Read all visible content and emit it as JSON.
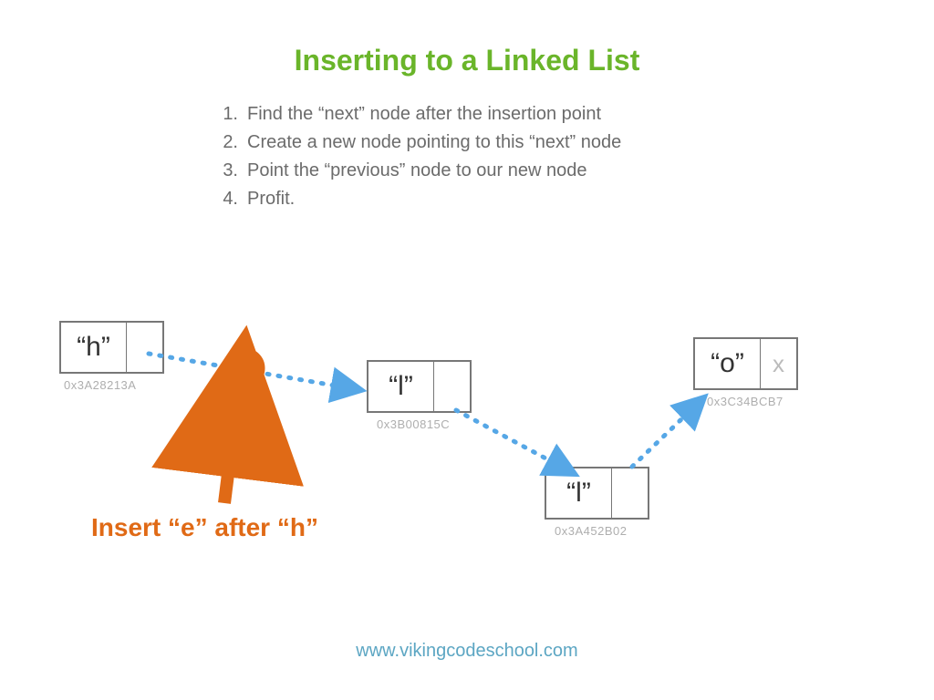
{
  "title": "Inserting to a Linked List",
  "steps": [
    "Find the “next” node after the insertion point",
    "Create a new node pointing to this “next” node",
    "Point the “previous” node to our new node",
    "Profit."
  ],
  "nodes": {
    "h": {
      "value": "“h”",
      "ptr": "",
      "addr": "0x3A28213A"
    },
    "l1": {
      "value": "“l”",
      "ptr": "",
      "addr": "0x3B00815C"
    },
    "l2": {
      "value": "“l”",
      "ptr": "",
      "addr": "0x3A452B02"
    },
    "o": {
      "value": "“o”",
      "ptr": "x",
      "addr": "0x3C34BCB7"
    }
  },
  "insert_label": "Insert “e” after “h”",
  "footer": "www.vikingcodeschool.com",
  "colors": {
    "title": "#6ab52a",
    "arrow_blue": "#56a7e6",
    "accent_orange": "#e06a16"
  }
}
